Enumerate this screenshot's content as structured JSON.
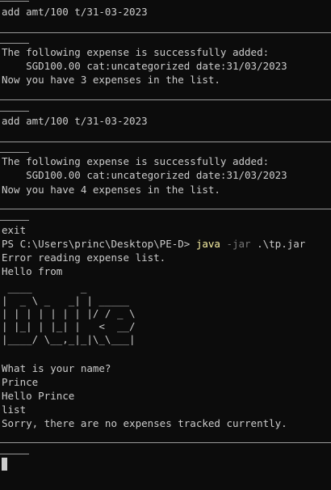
{
  "lines": [
    "add amt/100 t/31-03-2023",
    "The following expense is successfully added:",
    "    SGD100.00 cat:uncategorized date:31/03/2023",
    "Now you have 3 expenses in the list.",
    "add amt/100 t/31-03-2023",
    "The following expense is successfully added:",
    "    SGD100.00 cat:uncategorized date:31/03/2023",
    "Now you have 4 expenses in the list.",
    "exit",
    "Error reading expense list.",
    "Hello from",
    "What is your name?",
    "Prince",
    "Hello Prince",
    "list",
    "Sorry, there are no expenses tracked currently."
  ],
  "command": {
    "prompt": "PS C:\\Users\\princ\\Desktop\\PE-D> ",
    "program": "java",
    "flag": " -jar",
    "arg": " .\\tp.jar"
  },
  "ascii_art": [
    " ____        _        ",
    "|  _ \\ _   _| | _____ ",
    "| | | | | | | |/ / _ \\",
    "| |_| | |_| |   <  __/",
    "|____/ \\__,_|_|\\_\\___|"
  ],
  "colors": {
    "background": "#0c0c0c",
    "text": "#cccccc",
    "program": "#f9f1a5",
    "flag": "#767676"
  }
}
